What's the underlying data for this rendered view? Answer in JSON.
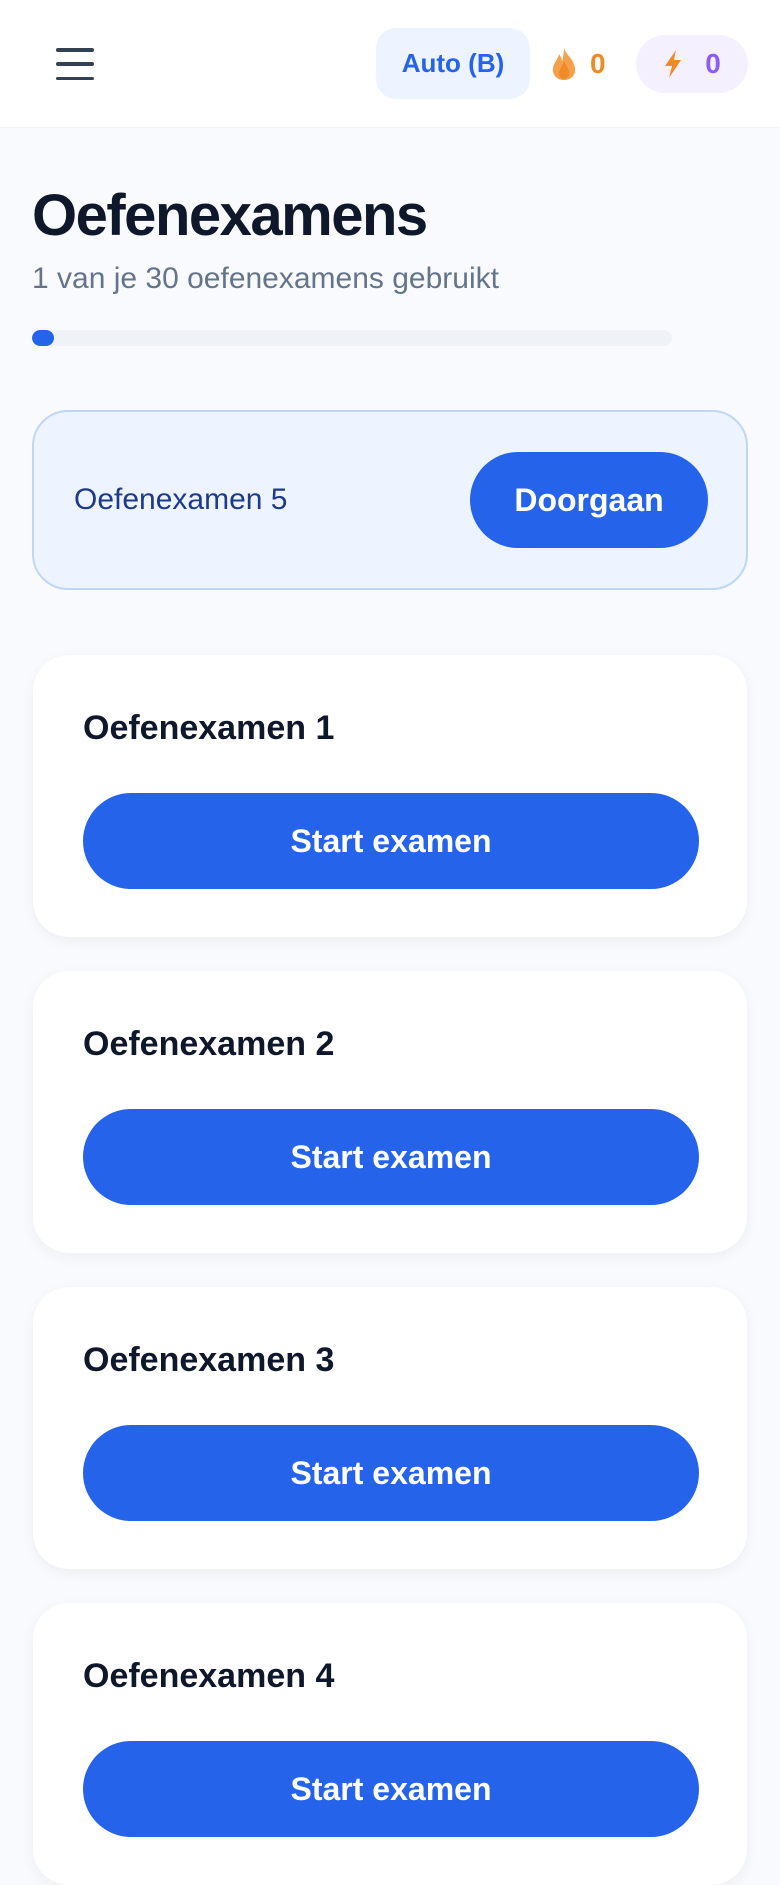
{
  "header": {
    "menu_icon": "hamburger-menu-icon",
    "license_label": "Auto (B)",
    "streak": {
      "icon": "flame-icon",
      "count": "0",
      "color": "#f08a24"
    },
    "xp": {
      "icon": "lightning-bolt-icon",
      "count": "0",
      "color": "#8b5cf6"
    }
  },
  "page": {
    "title": "Oefenexamens",
    "subtitle": "1 van je 30 oefenexamens gebruikt",
    "progress": {
      "used": 1,
      "total": 30,
      "fraction": 0.0333,
      "color": "#2563eb"
    }
  },
  "resume": {
    "label": "Oefenexamen 5",
    "button_label": "Doorgaan"
  },
  "exams": [
    {
      "title": "Oefenexamen 1",
      "button_label": "Start examen"
    },
    {
      "title": "Oefenexamen 2",
      "button_label": "Start examen"
    },
    {
      "title": "Oefenexamen 3",
      "button_label": "Start examen"
    },
    {
      "title": "Oefenexamen 4",
      "button_label": "Start examen"
    }
  ],
  "colors": {
    "accent": "#2563eb",
    "accent_light": "#eef4ff",
    "text_dark": "#0f172a",
    "text_muted": "#64748b"
  }
}
